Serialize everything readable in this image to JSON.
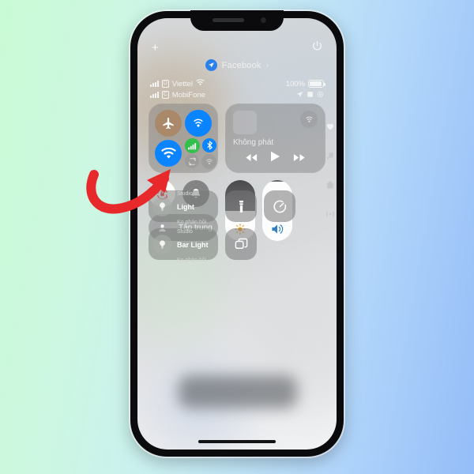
{
  "background": {
    "gradient_from": "#c9fbd5",
    "gradient_to": "#95bdf8"
  },
  "annotation": {
    "type": "curved-arrow",
    "color": "#e8292b",
    "points_to": "wifi-toggle"
  },
  "phone": {
    "control_center": {
      "top_bar": {
        "add_icon": "plus-icon",
        "power_icon": "power-icon"
      },
      "now_playing_banner": {
        "app": "Facebook",
        "chevron": "›"
      },
      "status_bar": {
        "carrier_primary": "Viettel",
        "carrier_secondary": "MobiFone",
        "sim_badge_primary": "D",
        "sim_badge_secondary": "C",
        "battery_percent": "100%",
        "wifi": "wifi-icon",
        "location_icon": "location-arrow-icon",
        "alarm_icon": "alarm-icon",
        "rotation_icon": "rotation-lock-icon"
      },
      "connectivity": {
        "airplane": {
          "name": "Airplane Mode",
          "state": "off",
          "color": "#a9896a"
        },
        "airdrop": {
          "name": "AirDrop",
          "state": "on",
          "color": "#0a84ff"
        },
        "wifi": {
          "name": "Wi-Fi",
          "state": "on",
          "color": "#0a84ff"
        },
        "cellular": {
          "name": "Cellular Data",
          "state": "on",
          "color": "#30c04b"
        },
        "bluetooth": {
          "name": "Bluetooth",
          "state": "on",
          "color": "#0a84ff"
        },
        "hotspot": {
          "name": "Personal Hotspot",
          "state": "off"
        },
        "airplay_small": {
          "name": "AirPlay",
          "state": "off"
        }
      },
      "media": {
        "track_title": "Không phát",
        "airplay_icon": "airplay-icon",
        "prev_label": "rewind-icon",
        "play_label": "play-icon",
        "next_label": "forward-icon"
      },
      "rotation_lock": {
        "name": "Rotation Lock",
        "state": "on"
      },
      "silent_mode": {
        "name": "Silent Mode",
        "state": "off"
      },
      "focus": {
        "label": "Tập trung",
        "state": "off"
      },
      "brightness": {
        "label": "Brightness",
        "percent": 50
      },
      "volume": {
        "label": "Volume",
        "percent": 97
      },
      "home_controls": [
        {
          "room": "Studio",
          "name": "Light",
          "status": "Ko phản hồi"
        },
        {
          "room": "Studio",
          "name": "Bar Light",
          "status": "Ko phản hồi"
        }
      ],
      "flashlight": {
        "name": "Flashlight",
        "state": "off"
      },
      "timer": {
        "name": "Timer",
        "state": "off"
      },
      "screen_mirroring": {
        "name": "Screen Mirroring",
        "state": "off"
      },
      "side_icons": [
        "heart-icon",
        "music-note-icon",
        "home-icon",
        "broadcast-icon"
      ]
    }
  }
}
